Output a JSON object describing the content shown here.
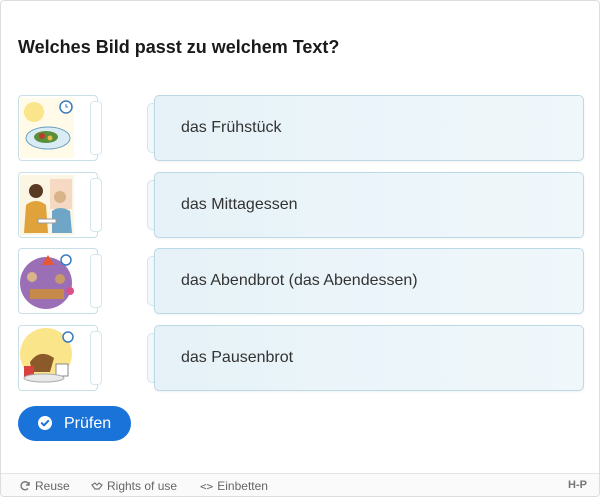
{
  "task": {
    "question": "Welches Bild passt zu welchem Text?"
  },
  "rows": [
    {
      "label": "das Frühstück",
      "image_icon": "breakfast-picture-icon"
    },
    {
      "label": "das Mittagessen",
      "image_icon": "lunch-picture-icon"
    },
    {
      "label": "das Abendbrot (das Abendessen)",
      "image_icon": "dinner-picture-icon"
    },
    {
      "label": "das Pausenbrot",
      "image_icon": "snack-picture-icon"
    }
  ],
  "actions": {
    "check_label": "Prüfen"
  },
  "footer": {
    "reuse": "Reuse",
    "rights": "Rights of use",
    "embed": "Einbetten",
    "brand": "H-P"
  },
  "colors": {
    "accent": "#1a73d9",
    "card_border": "#bcd9e6",
    "card_bg": "#e6f2f8"
  }
}
